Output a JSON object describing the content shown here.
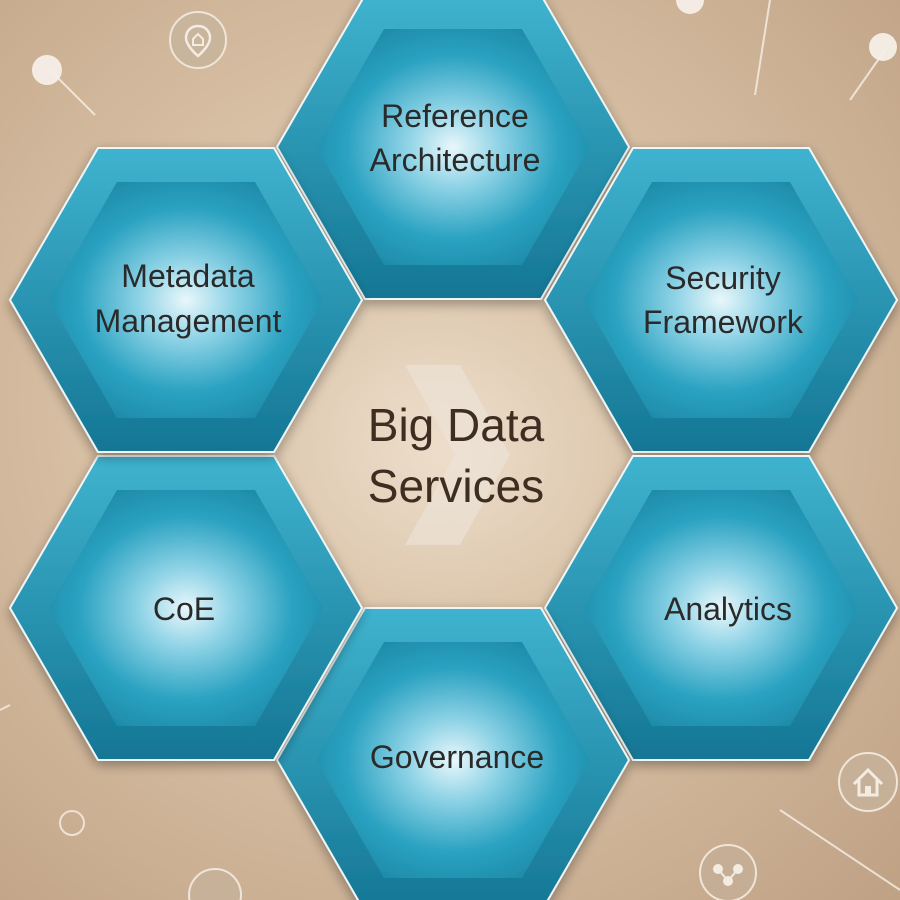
{
  "center": {
    "lines": [
      "Big Data",
      "Services"
    ]
  },
  "hexagons": [
    {
      "id": "reference-architecture",
      "lines": [
        "Reference",
        "Architecture"
      ]
    },
    {
      "id": "security-framework",
      "lines": [
        "Security",
        "Framework"
      ]
    },
    {
      "id": "analytics",
      "lines": [
        "Analytics"
      ]
    },
    {
      "id": "governance",
      "lines": [
        "Governance"
      ]
    },
    {
      "id": "coe",
      "lines": [
        "CoE"
      ]
    },
    {
      "id": "metadata-management",
      "lines": [
        "Metadata",
        "Management"
      ]
    }
  ],
  "colors": {
    "hex_outer": "#1f8fae",
    "hex_inner_glow": "#e6f6fb",
    "hex_rim": "#14718d",
    "background": "#d8c0a4",
    "text": "#2b2b2b"
  },
  "icons": [
    "home-icon",
    "share-icon",
    "location-pin-icon"
  ]
}
